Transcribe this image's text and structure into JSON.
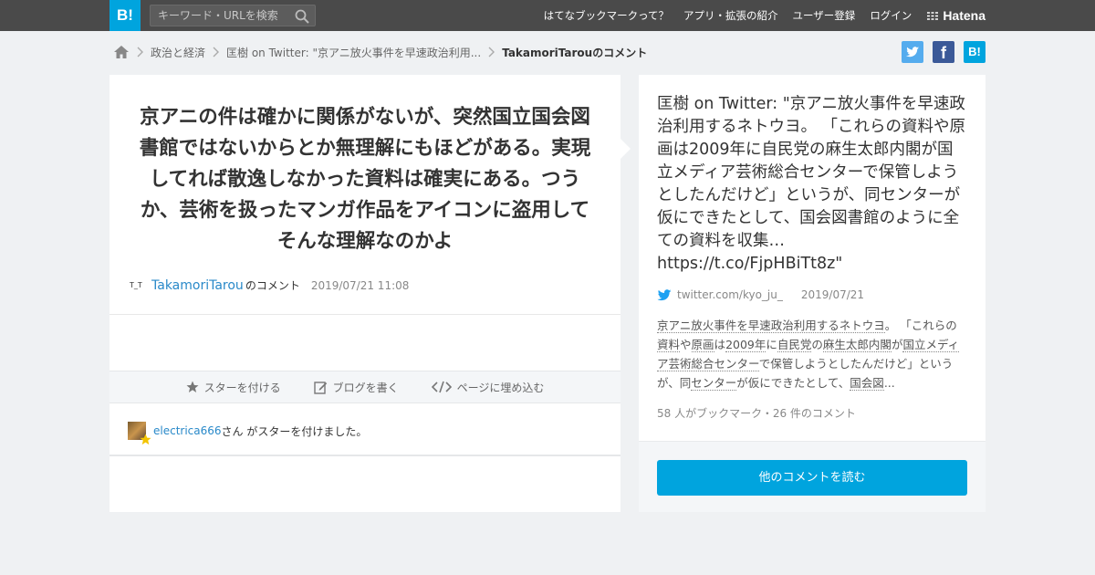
{
  "topbar": {
    "logo_text": "B!",
    "search_placeholder": "キーワード・URLを検索",
    "nav": [
      {
        "label": "はてなブックマークって？"
      },
      {
        "label": "アプリ・拡張の紹介"
      },
      {
        "label": "ユーザー登録"
      },
      {
        "label": "ログイン"
      }
    ],
    "brand": "Hatena"
  },
  "breadcrumb": {
    "items": [
      "政治と経済",
      "匡樹 on Twitter: \"京アニ放火事件を早速政治利用...",
      "TakamoriTarouのコメント"
    ]
  },
  "share": {
    "facebook": "f",
    "hatena": "B!"
  },
  "comment": {
    "text": "京アニの件は確かに関係がないが、突然国立国会図書館ではないからとか無理解にもほどがある。実現してれば散逸しなかった資料は確実にある。つうか、芸術を扱ったマンガ作品をアイコンに盗用してそんな理解なのかよ",
    "avatar_text": "T_T",
    "user": "TakamoriTarou",
    "user_suffix": "のコメント",
    "date": "2019/07/21 11:08"
  },
  "actions": {
    "star": "スターを付ける",
    "blog": "ブログを書く",
    "embed": "ページに埋め込む"
  },
  "stars": {
    "user": "electrica666",
    "text": "さん がスターを付けました。"
  },
  "entry": {
    "title": "匡樹 on Twitter: \"京アニ放火事件を早速政治利用するネトウヨ。 「これらの資料や原画は2009年に自民党の麻生太郎内閣が国立メディア芸術総合センターで保管しようとしたんだけど」というが、同センターが仮にできたとして、国会図書館のように全ての資料を収集… https://t.co/FjpHBiTt8z\"",
    "source": "twitter.com/kyo_ju_",
    "date": "2019/07/21",
    "summary_parts": [
      {
        "t": "京アニ放火事件を早速政治利用するネトウヨ",
        "u": true
      },
      {
        "t": "。 「これらの",
        "u": false
      },
      {
        "t": "資料",
        "u": true
      },
      {
        "t": "や",
        "u": false
      },
      {
        "t": "原画",
        "u": true
      },
      {
        "t": "は",
        "u": false
      },
      {
        "t": "2009年",
        "u": true
      },
      {
        "t": "に",
        "u": false
      },
      {
        "t": "自民党",
        "u": true
      },
      {
        "t": "の",
        "u": false
      },
      {
        "t": "麻生太郎内閣",
        "u": true
      },
      {
        "t": "が",
        "u": false
      },
      {
        "t": "国立メディア芸術総合センター",
        "u": true
      },
      {
        "t": "で保管しようとしたんだけど」というが、同",
        "u": false
      },
      {
        "t": "センター",
        "u": true
      },
      {
        "t": "が仮にできたとして、",
        "u": false
      },
      {
        "t": "国会図",
        "u": true
      },
      {
        "t": "...",
        "u": false
      }
    ],
    "counts": "58 人がブックマーク・26 件のコメント",
    "read_button": "他のコメントを読む"
  },
  "colors": {
    "brand_blue": "#00a4de",
    "link_blue": "#2989c9",
    "topbar": "#4a4a4a",
    "twitter": "#55acee",
    "facebook": "#3b5998",
    "star": "#f3c400"
  }
}
